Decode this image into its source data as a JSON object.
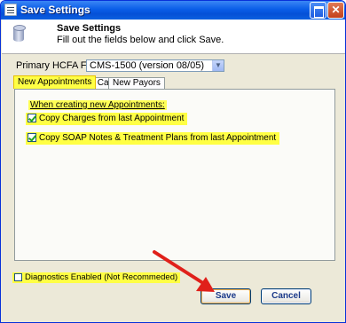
{
  "window": {
    "title": "Save Settings"
  },
  "header": {
    "title": "Save Settings",
    "subtitle": "Fill out the fields below and click Save."
  },
  "form": {
    "label": "Primary HCFA Form",
    "selected": "CMS-1500 (version 08/05)"
  },
  "tabs": [
    {
      "label": "New Appointments",
      "active": true
    },
    {
      "label": "New Cases",
      "active": false
    },
    {
      "label": "New Payors",
      "active": false
    }
  ],
  "panel": {
    "group_title": "When creating new Appointments:",
    "checkboxes": [
      {
        "label": "Copy Charges from last Appointment",
        "checked": true
      },
      {
        "label": "Copy SOAP Notes & Treatment Plans from last Appointment",
        "checked": true
      }
    ]
  },
  "diagnostics": {
    "label": "Diagnostics Enabled (Not Recommeded)",
    "checked": false
  },
  "buttons": {
    "save": "Save",
    "cancel": "Cancel"
  },
  "colors": {
    "highlight": "#ffff44",
    "arrow": "#e0201a",
    "titlebar": "#0a5ee8"
  },
  "icons": [
    "window-icon",
    "database-icon",
    "maximize-icon",
    "close-icon",
    "annotation-arrow-icon"
  ]
}
